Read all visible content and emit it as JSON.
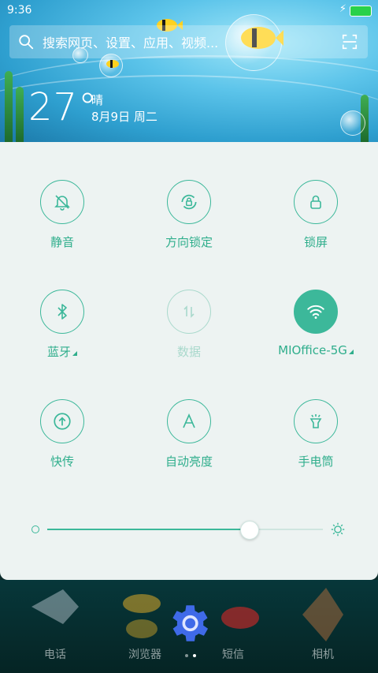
{
  "status_bar": {
    "time": "9:36"
  },
  "search": {
    "placeholder": "搜索网页、设置、应用、视频..."
  },
  "weather": {
    "temperature": "27°",
    "condition": "晴",
    "date": "8月9日 周二"
  },
  "toggles": [
    {
      "label": "静音",
      "icon": "bell-off-icon",
      "state": "off"
    },
    {
      "label": "方向锁定",
      "icon": "rotation-lock-icon",
      "state": "off"
    },
    {
      "label": "锁屏",
      "icon": "lock-icon",
      "state": "off"
    },
    {
      "label": "蓝牙",
      "icon": "bluetooth-icon",
      "state": "off"
    },
    {
      "label": "数据",
      "icon": "data-icon",
      "state": "disabled"
    },
    {
      "label": "MIOffice-5G",
      "icon": "wifi-icon",
      "state": "on"
    },
    {
      "label": "快传",
      "icon": "share-icon",
      "state": "off"
    },
    {
      "label": "自动亮度",
      "icon": "auto-brightness-icon",
      "state": "off"
    },
    {
      "label": "手电筒",
      "icon": "flashlight-icon",
      "state": "off"
    }
  ],
  "brightness": {
    "level": 0.73
  },
  "dock": {
    "apps": [
      "电话",
      "浏览器",
      "短信",
      "相机"
    ]
  },
  "colors": {
    "accent": "#3cb89a",
    "panel_bg": "#edf3f2"
  }
}
